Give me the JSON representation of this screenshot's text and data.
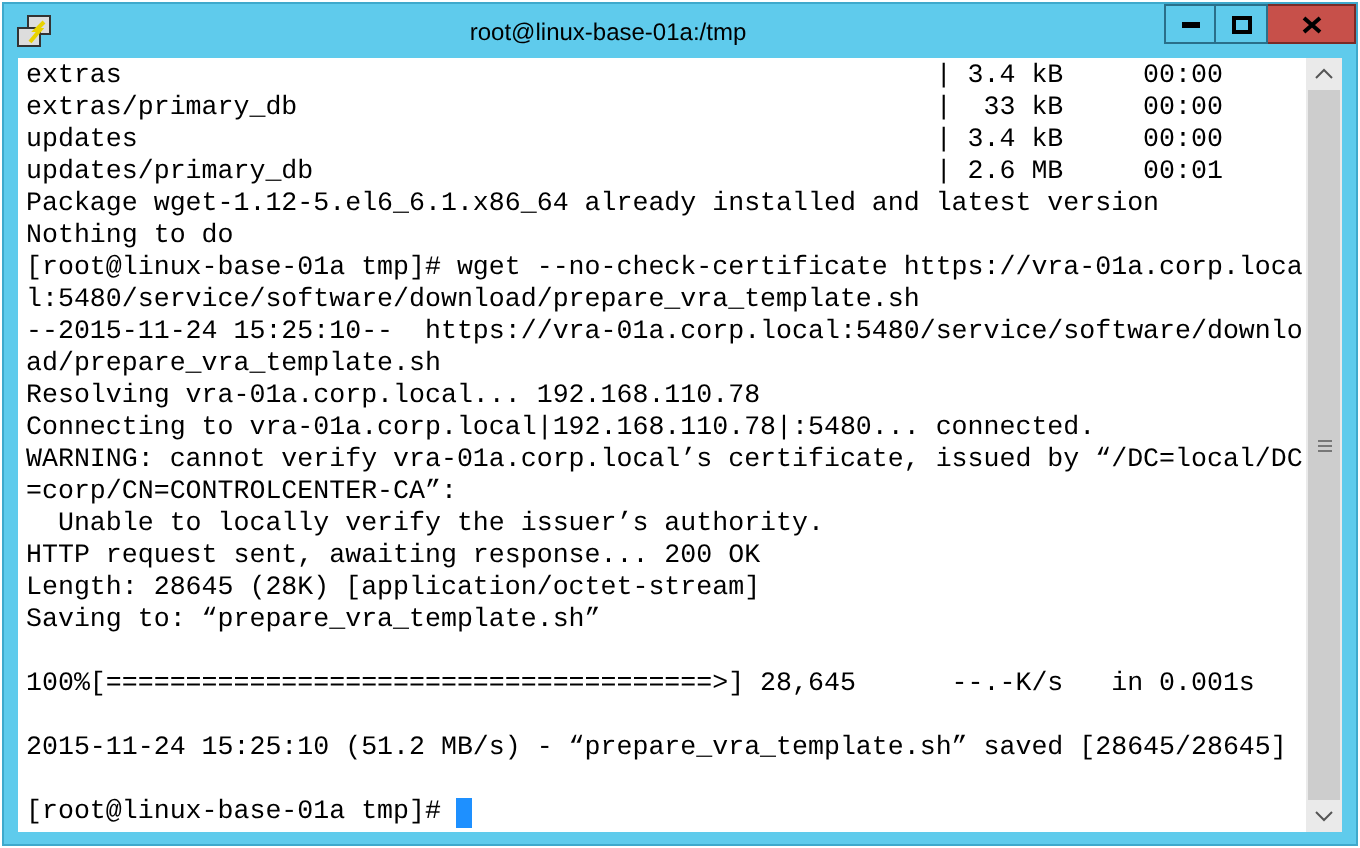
{
  "window": {
    "title": "root@linux-base-01a:/tmp"
  },
  "terminal": {
    "lines": [
      {
        "kind": "output",
        "text": "extras                                                   | 3.4 kB     00:00"
      },
      {
        "kind": "output",
        "text": "extras/primary_db                                        |  33 kB     00:00"
      },
      {
        "kind": "output",
        "text": "updates                                                  | 3.4 kB     00:00"
      },
      {
        "kind": "output",
        "text": "updates/primary_db                                       | 2.6 MB     00:01"
      },
      {
        "kind": "output",
        "text": "Package wget-1.12-5.el6_6.1.x86_64 already installed and latest version"
      },
      {
        "kind": "output",
        "text": "Nothing to do"
      },
      {
        "kind": "output",
        "text": "[root@linux-base-01a tmp]# wget --no-check-certificate https://vra-01a.corp.loca"
      },
      {
        "kind": "output",
        "text": "l:5480/service/software/download/prepare_vra_template.sh"
      },
      {
        "kind": "output",
        "text": "--2015-11-24 15:25:10--  https://vra-01a.corp.local:5480/service/software/downlo"
      },
      {
        "kind": "output",
        "text": "ad/prepare_vra_template.sh"
      },
      {
        "kind": "output",
        "text": "Resolving vra-01a.corp.local... 192.168.110.78"
      },
      {
        "kind": "output",
        "text": "Connecting to vra-01a.corp.local|192.168.110.78|:5480... connected."
      },
      {
        "kind": "output",
        "text": "WARNING: cannot verify vra-01a.corp.local’s certificate, issued by “/DC=local/DC"
      },
      {
        "kind": "output",
        "text": "=corp/CN=CONTROLCENTER-CA”:"
      },
      {
        "kind": "output",
        "text": "  Unable to locally verify the issuer’s authority."
      },
      {
        "kind": "output",
        "text": "HTTP request sent, awaiting response... 200 OK"
      },
      {
        "kind": "output",
        "text": "Length: 28645 (28K) [application/octet-stream]"
      },
      {
        "kind": "output",
        "text": "Saving to: “prepare_vra_template.sh”"
      },
      {
        "kind": "blank"
      },
      {
        "kind": "output",
        "text": "100%[======================================>] 28,645      --.-K/s   in 0.001s"
      },
      {
        "kind": "blank"
      },
      {
        "kind": "output",
        "text": "2015-11-24 15:25:10 (51.2 MB/s) - “prepare_vra_template.sh” saved [28645/28645]"
      },
      {
        "kind": "blank"
      },
      {
        "kind": "prompt",
        "text": "[root@linux-base-01a tmp]# ",
        "cursor": true
      }
    ]
  }
}
